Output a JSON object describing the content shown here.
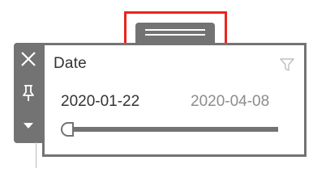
{
  "filter_card": {
    "title": "Date",
    "range": {
      "start": "2020-01-22",
      "end": "2020-04-08",
      "selected_start_fraction": 0.0,
      "selected_end_fraction": 1.0
    }
  },
  "toolbar": {
    "icons": [
      "close-icon",
      "pin-icon",
      "dropdown-icon"
    ]
  },
  "drag_handle": {
    "icon": "drag-grip-icon",
    "highlighted": true
  },
  "colors": {
    "chrome_gray": "#737373",
    "highlight_red": "#e8251c",
    "title_text": "#333333",
    "muted_text": "#8c8c8c"
  }
}
